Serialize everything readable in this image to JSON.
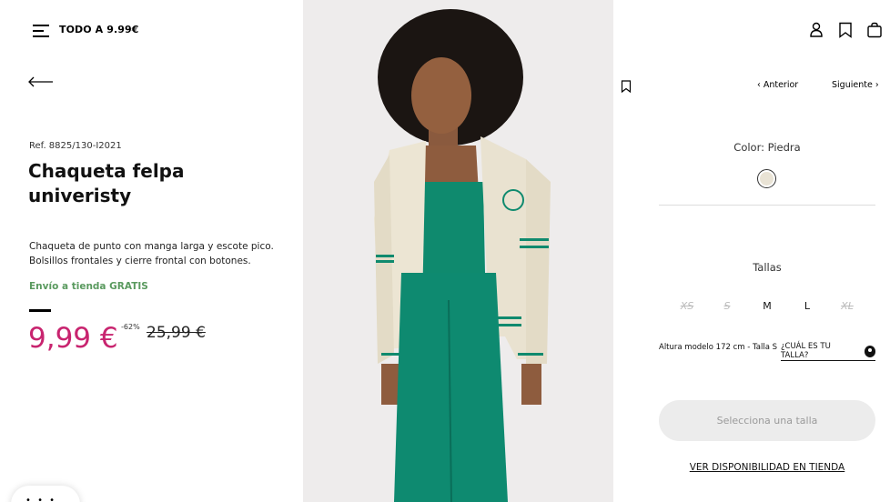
{
  "header": {
    "promo_label": "TODO A 9.99€"
  },
  "product": {
    "ref": "Ref. 8825/130-I2021",
    "title": "Chaqueta felpa univeristy",
    "description": "Chaqueta de punto con manga larga y escote pico. Bolsillos frontales y cierre frontal con botones.",
    "shipping": "Envío a tienda GRATIS",
    "price": "9,99 €",
    "discount": "-62%",
    "old_price": "25,99 €"
  },
  "navigation": {
    "prev": "‹ Anterior",
    "next": "Siguiente ›"
  },
  "color": {
    "label": "Color: Piedra",
    "swatch_hex": "#e9e3d5"
  },
  "sizes": {
    "label": "Tallas",
    "items": [
      {
        "label": "XS",
        "available": false
      },
      {
        "label": "S",
        "available": false
      },
      {
        "label": "M",
        "available": true
      },
      {
        "label": "L",
        "available": true
      },
      {
        "label": "XL",
        "available": false
      }
    ],
    "model_info": "Altura modelo 172 cm - Talla S",
    "guide_link": "¿CUÁL ES TU TALLA?"
  },
  "actions": {
    "select_size": "Selecciona una talla",
    "store_availability": "VER DISPONIBILIDAD EN TIENDA"
  },
  "colors": {
    "price": "#c8246f",
    "shipping": "#5a9a5f",
    "jacket": "#ece5d3",
    "green": "#0f8a6e"
  }
}
